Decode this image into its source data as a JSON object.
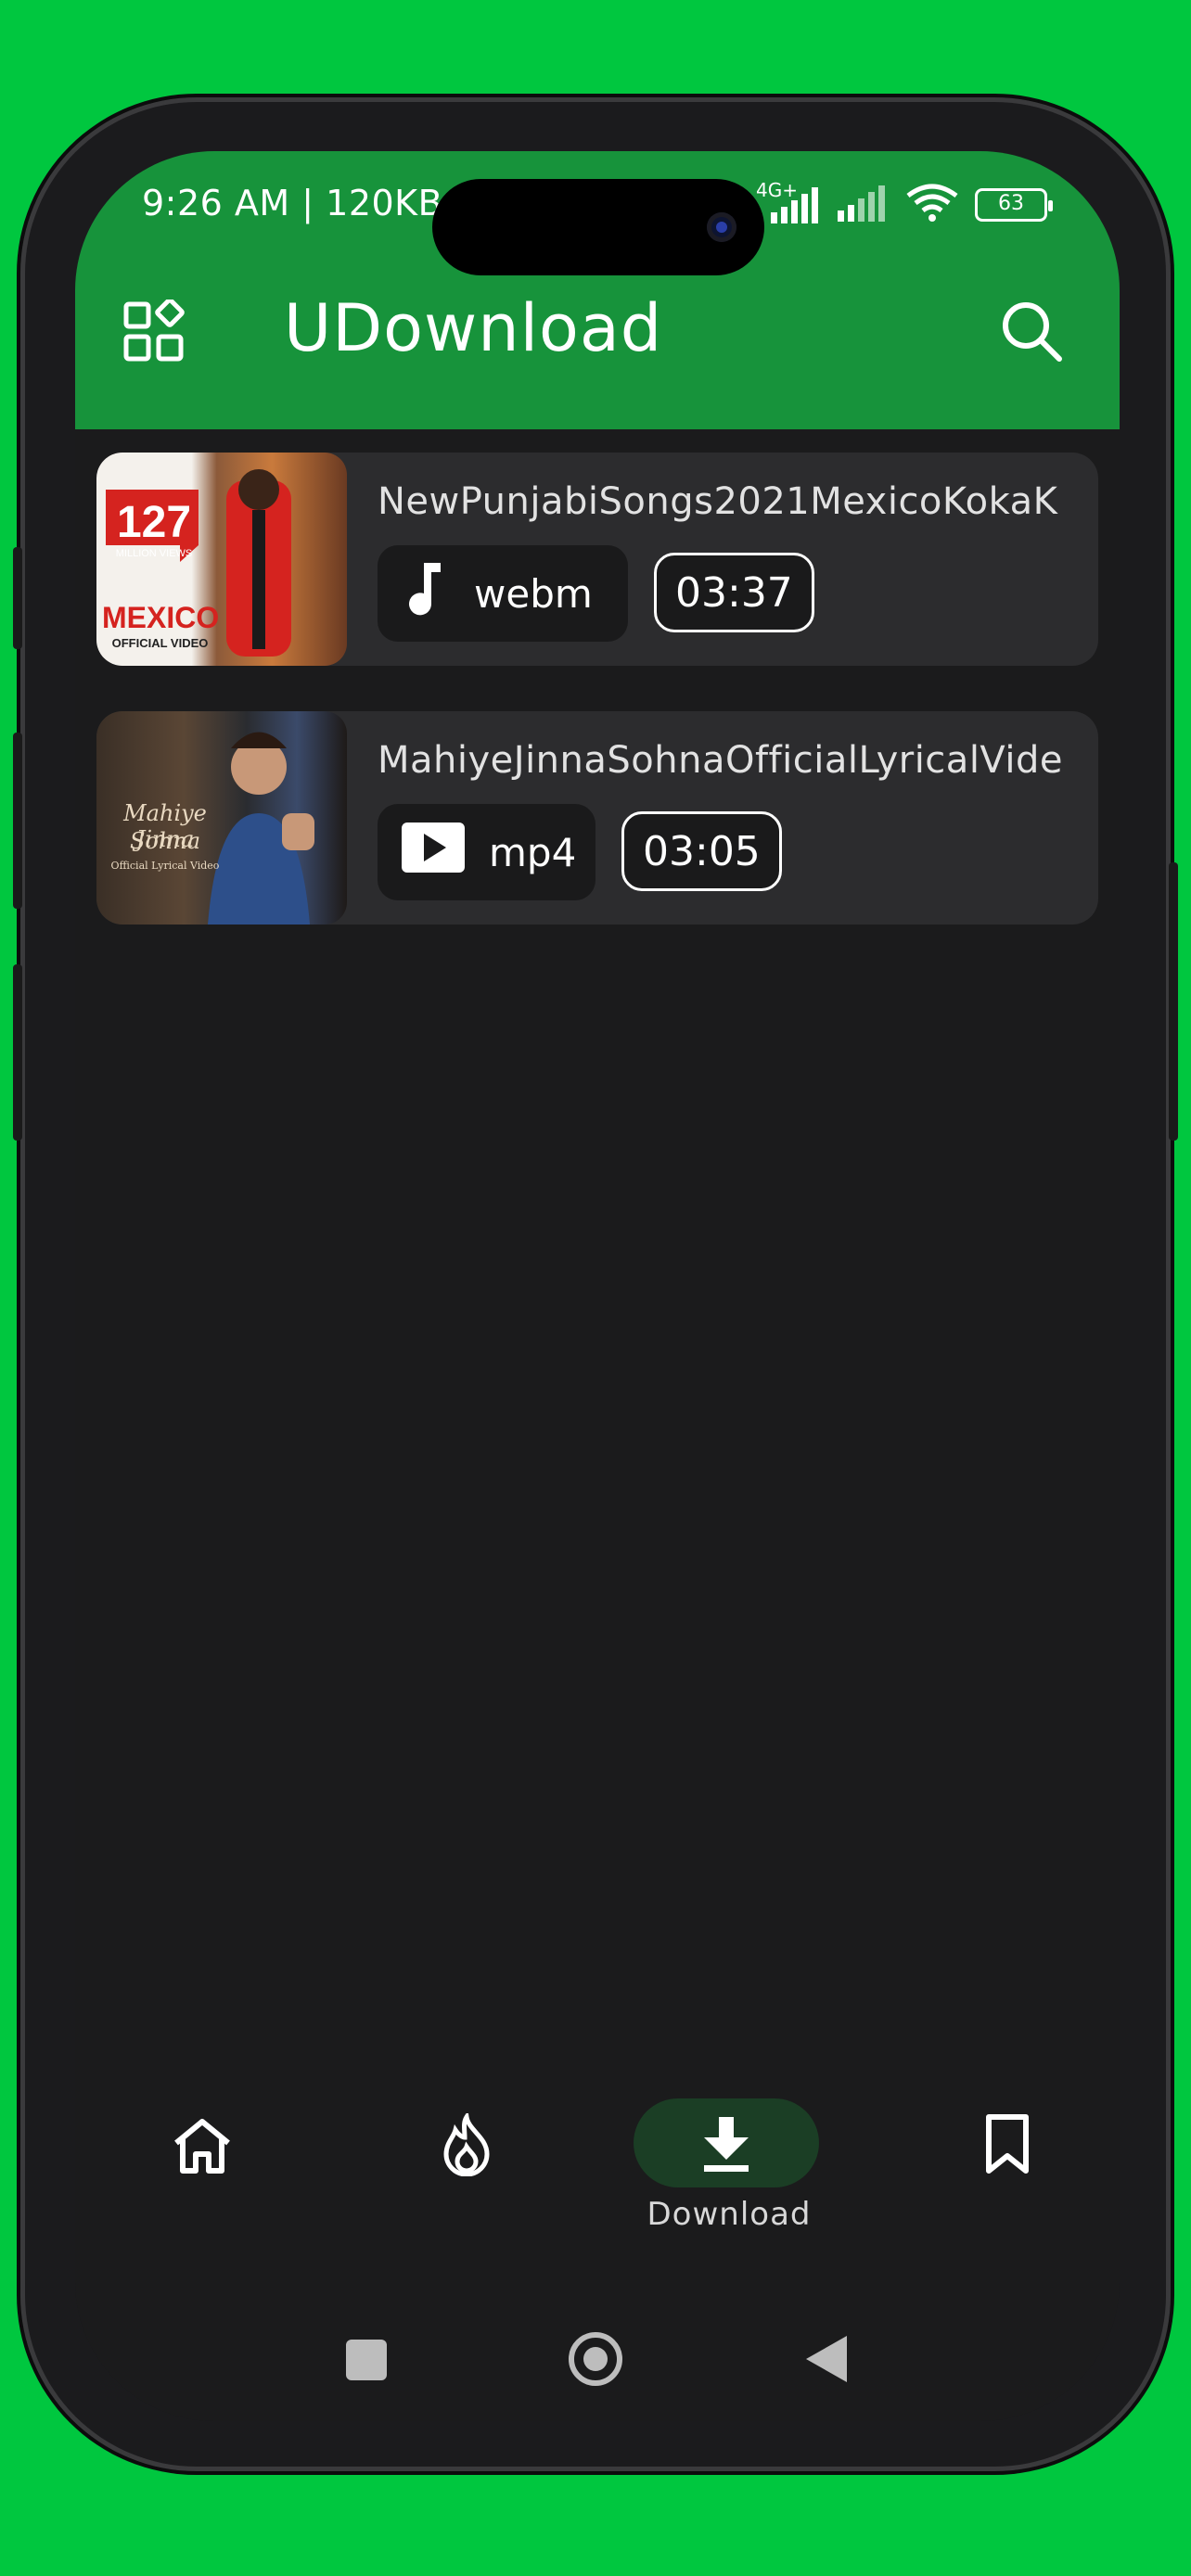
{
  "status_bar": {
    "time_speed": "9:26 AM | 120KB",
    "network": "4G+",
    "battery": "63"
  },
  "app_bar": {
    "title": "UDownload",
    "left_icon": "grid-apps-icon",
    "right_icon": "search-icon"
  },
  "downloads": [
    {
      "title": "NewPunjabiSongs2021MexicoKokaK",
      "format": "webm",
      "format_icon": "music-note-icon",
      "duration": "03:37",
      "thumbnail": {
        "big": "127",
        "small": "MILLION VIEWS",
        "name": "MEXICO",
        "sub": "OFFICIAL VIDEO"
      }
    },
    {
      "title": "MahiyeJinnaSohnaOfficialLyricalVide",
      "format": "mp4",
      "format_icon": "play-icon",
      "duration": "03:05",
      "thumbnail": {
        "line1": "Mahiye Jinna",
        "line2": "Sohna",
        "sub": "Official Lyrical Video"
      }
    }
  ],
  "bottom_nav": {
    "items": [
      {
        "icon": "home-icon"
      },
      {
        "icon": "trending-fire-icon"
      },
      {
        "icon": "download-icon",
        "label": "Download",
        "active": true
      },
      {
        "icon": "bookmark-icon"
      }
    ]
  },
  "system_nav": [
    "recents-square-icon",
    "home-circle-icon",
    "back-triangle-icon"
  ],
  "colors": {
    "background": "#00c73f",
    "header": "#17933b",
    "surface": "#1b1b1c",
    "card": "#2c2c2e",
    "nav_active": "#1b3e25"
  }
}
